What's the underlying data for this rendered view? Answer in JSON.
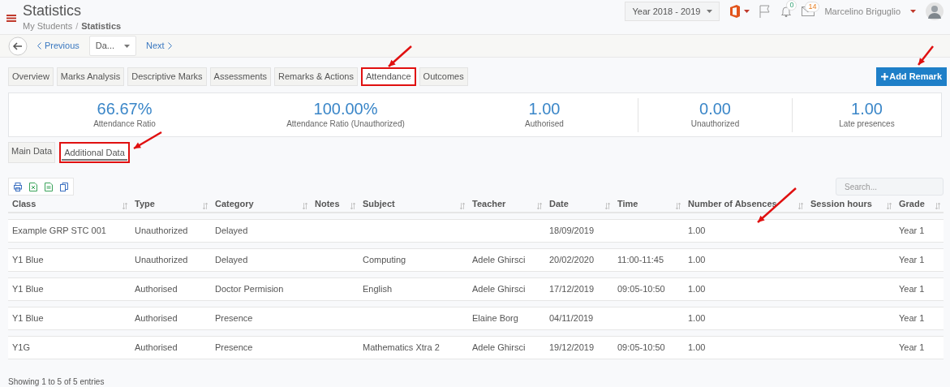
{
  "header": {
    "title": "Statistics",
    "breadcrumb_separator": "/",
    "breadcrumb": [
      {
        "label": "My Students",
        "current": false
      },
      {
        "label": "Statistics",
        "current": true
      }
    ],
    "year_select": "Year 2018 - 2019",
    "notifications": "0",
    "messages": "14",
    "user": "Marcelino Briguglio"
  },
  "nav": {
    "previous": "Previous",
    "select": "Da...",
    "next": "Next"
  },
  "tabs": [
    {
      "label": "Overview",
      "selected": false,
      "highlighted": false
    },
    {
      "label": "Marks Analysis",
      "selected": false,
      "highlighted": false
    },
    {
      "label": "Descriptive Marks",
      "selected": false,
      "highlighted": false
    },
    {
      "label": "Assessments",
      "selected": false,
      "highlighted": false
    },
    {
      "label": "Remarks & Actions",
      "selected": false,
      "highlighted": false
    },
    {
      "label": "Attendance",
      "selected": true,
      "highlighted": true
    },
    {
      "label": "Outcomes",
      "selected": false,
      "highlighted": false
    }
  ],
  "add_button": "Add Remark",
  "stats": [
    {
      "value": "66.67%",
      "label": "Attendance Ratio"
    },
    {
      "value": "100.00%",
      "label": "Attendance Ratio (Unauthorized)"
    },
    {
      "value": "1.00",
      "label": "Authorised"
    },
    {
      "value": "0.00",
      "label": "Unauthorized"
    },
    {
      "value": "1.00",
      "label": "Late presences"
    }
  ],
  "sub_tabs": [
    {
      "label": "Main Data",
      "selected": false,
      "highlighted": false
    },
    {
      "label": "Additional Data",
      "selected": true,
      "highlighted": true
    }
  ],
  "search": {
    "placeholder": "Search..."
  },
  "table": {
    "columns": [
      "Class",
      "Type",
      "Category",
      "Notes",
      "Subject",
      "Teacher",
      "Date",
      "Time",
      "Number of Absences",
      "Session hours",
      "Grade"
    ],
    "rows": [
      [
        "Example GRP STC 001",
        "Unauthorized",
        "Delayed",
        "",
        "",
        "",
        "18/09/2019",
        "",
        "1.00",
        "",
        "Year 1"
      ],
      [
        "Y1 Blue",
        "Unauthorized",
        "Delayed",
        "",
        "Computing",
        "Adele Ghirsci",
        "20/02/2020",
        "11:00-11:45",
        "1.00",
        "",
        "Year 1"
      ],
      [
        "Y1 Blue",
        "Authorised",
        "Doctor Permision",
        "",
        "English",
        "Adele Ghirsci",
        "17/12/2019",
        "09:05-10:50",
        "1.00",
        "",
        "Year 1"
      ],
      [
        "Y1 Blue",
        "Authorised",
        "Presence",
        "",
        "",
        "Elaine Borg",
        "04/11/2019",
        "",
        "1.00",
        "",
        "Year 1"
      ],
      [
        "Y1G",
        "Authorised",
        "Presence",
        "",
        "Mathematics Xtra 2",
        "Adele Ghirsci",
        "19/12/2019",
        "09:05-10:50",
        "1.00",
        "",
        "Year 1"
      ]
    ]
  },
  "footer": "Showing 1 to 5 of 5 entries"
}
